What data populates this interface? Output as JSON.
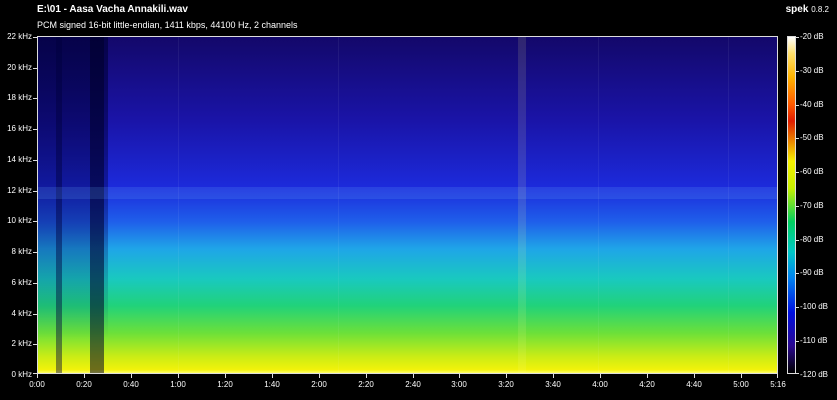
{
  "header": {
    "file_title": "E:\\01 - Aasa Vacha Annakili.wav",
    "stream_info": "PCM signed 16-bit little-endian, 1411 kbps, 44100 Hz, 2 channels",
    "app_name": "spek",
    "app_version": "0.8.2"
  },
  "frequency_axis": {
    "labels": [
      "22 kHz",
      "20 kHz",
      "18 kHz",
      "16 kHz",
      "14 kHz",
      "12 kHz",
      "10 kHz",
      "8 kHz",
      "6 kHz",
      "4 kHz",
      "2 kHz",
      "0 kHz"
    ]
  },
  "time_axis": {
    "labels": [
      "0:00",
      "0:20",
      "0:40",
      "1:00",
      "1:20",
      "1:40",
      "2:00",
      "2:20",
      "2:40",
      "3:00",
      "3:20",
      "3:40",
      "4:00",
      "4:20",
      "4:40",
      "5:00",
      "5:16"
    ]
  },
  "db_scale": {
    "labels": [
      "-20 dB",
      "-30 dB",
      "-40 dB",
      "-50 dB",
      "-60 dB",
      "-70 dB",
      "-80 dB",
      "-90 dB",
      "-100 dB",
      "-110 dB",
      "-120 dB"
    ]
  },
  "colors": {
    "background": "#000000",
    "text": "#ffffff",
    "border": "#dddddd"
  }
}
